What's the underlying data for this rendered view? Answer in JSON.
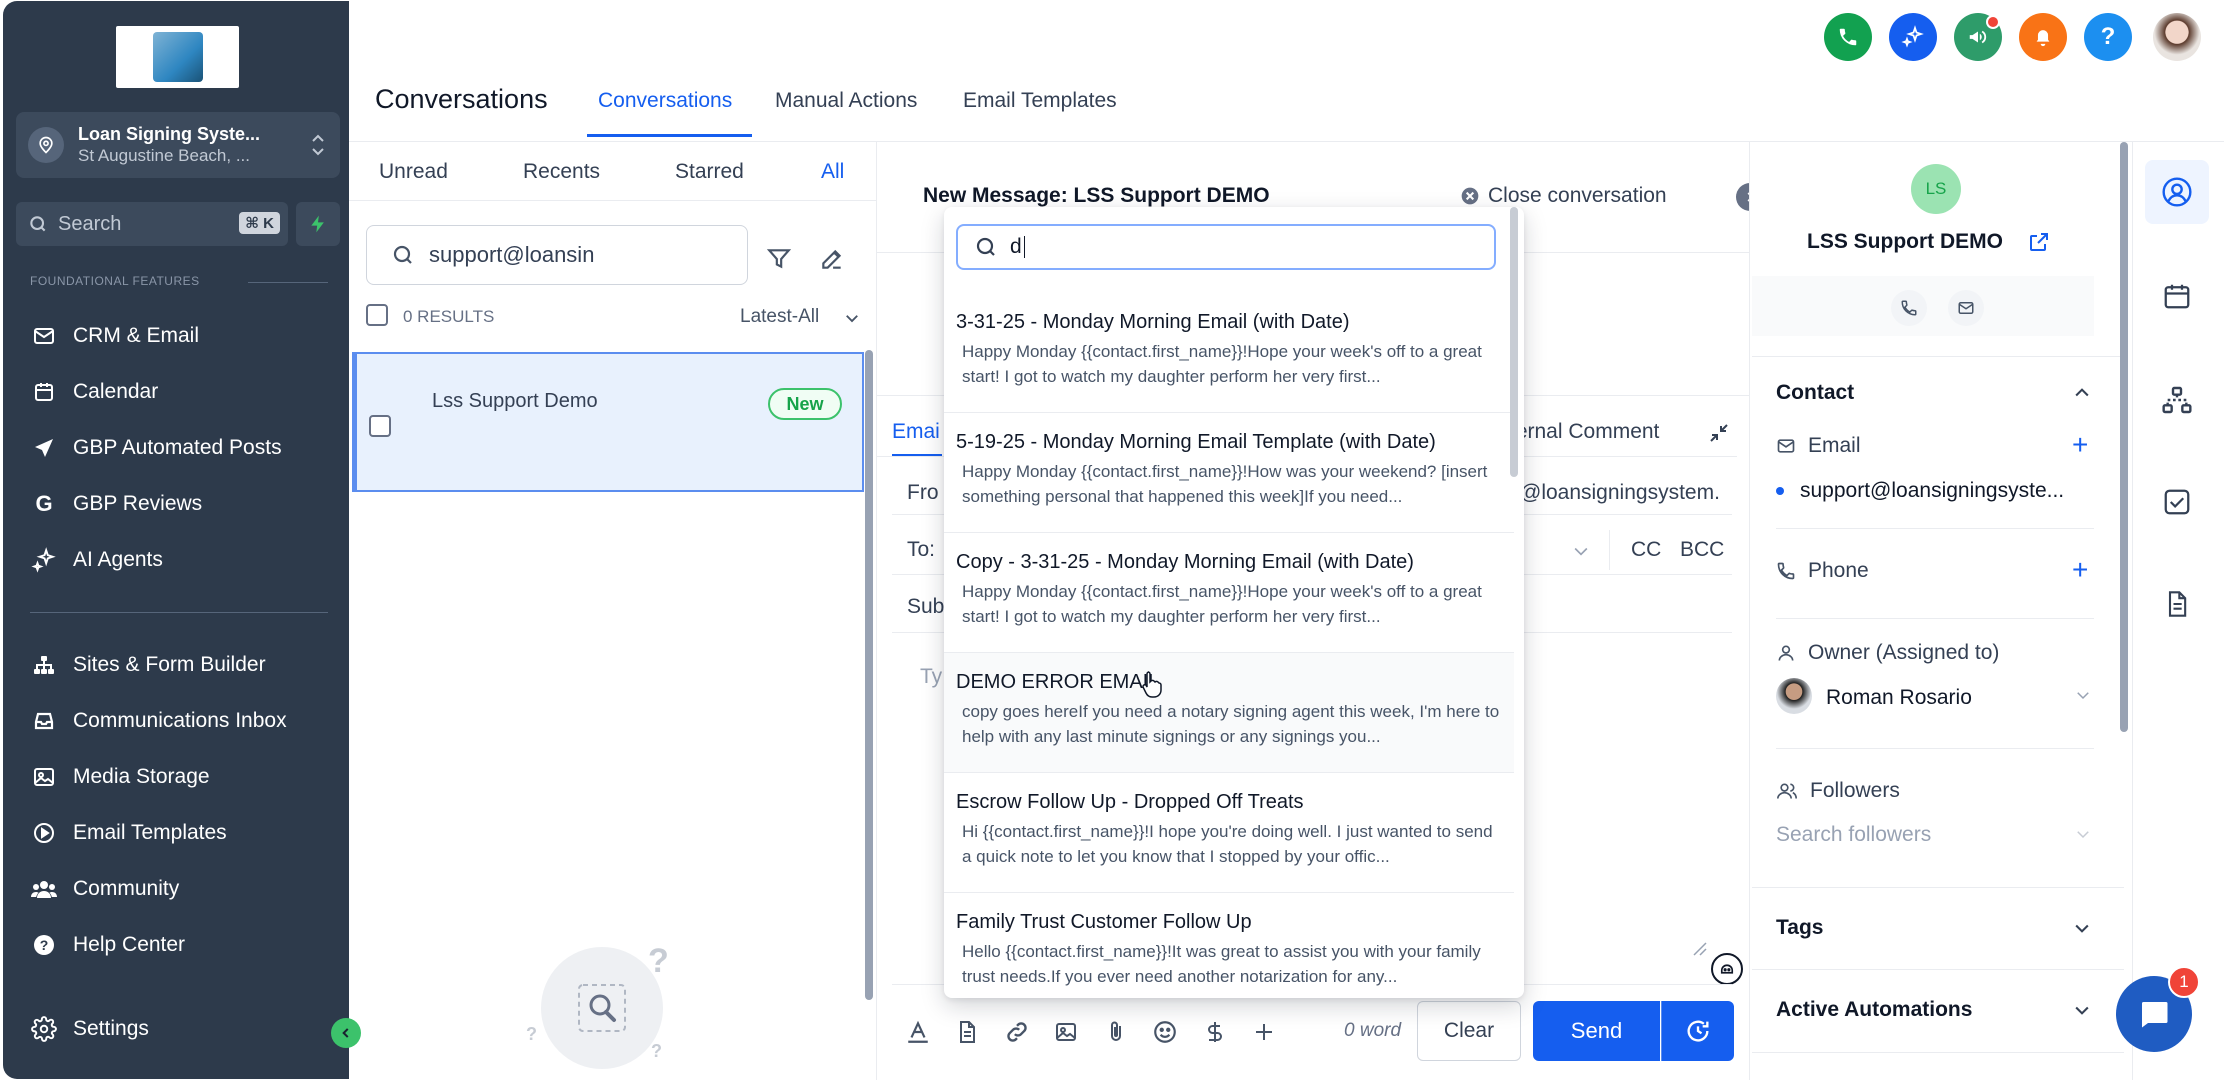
{
  "sidebar": {
    "location_name": "Loan Signing Syste...",
    "location_sub": "St Augustine Beach, ...",
    "search_placeholder": "Search",
    "search_shortcut": "⌘ K",
    "section_label": "FOUNDATIONAL FEATURES",
    "items_group1": [
      {
        "label": "CRM & Email",
        "icon": "mail-icon"
      },
      {
        "label": "Calendar",
        "icon": "calendar-icon"
      },
      {
        "label": "GBP Automated Posts",
        "icon": "send-arrow-icon"
      },
      {
        "label": "GBP Reviews",
        "icon": "google-g-icon"
      },
      {
        "label": "AI Agents",
        "icon": "sparkles-icon"
      }
    ],
    "items_group2": [
      {
        "label": "Sites & Form Builder",
        "icon": "sitemap-icon"
      },
      {
        "label": "Communications Inbox",
        "icon": "inbox-icon"
      },
      {
        "label": "Media Storage",
        "icon": "image-icon"
      },
      {
        "label": "Email Templates",
        "icon": "play-circle-icon"
      },
      {
        "label": "Community",
        "icon": "users-icon"
      },
      {
        "label": "Help Center",
        "icon": "question-circle-icon"
      }
    ],
    "settings_label": "Settings"
  },
  "header": {
    "page_title": "Conversations",
    "tabs": [
      {
        "label": "Conversations",
        "active": true
      },
      {
        "label": "Manual Actions",
        "active": false
      },
      {
        "label": "Email Templates",
        "active": false
      }
    ],
    "top_icons": [
      {
        "name": "phone-icon",
        "color": "#12a150"
      },
      {
        "name": "ai-sparkle-icon",
        "color": "#155eef"
      },
      {
        "name": "megaphone-icon",
        "color": "#2e9c6a"
      },
      {
        "name": "bell-icon",
        "color": "#f97316"
      },
      {
        "name": "help-icon",
        "color": "#1c8ff0"
      }
    ]
  },
  "list": {
    "filter_tabs": [
      {
        "label": "Unread",
        "active": false
      },
      {
        "label": "Recents",
        "active": false
      },
      {
        "label": "Starred",
        "active": false
      },
      {
        "label": "All",
        "active": true
      }
    ],
    "search_value": "support@loansin",
    "results_count": "0 RESULTS",
    "sort_label": "Latest-All",
    "conversation": {
      "name": "Lss Support Demo",
      "badge": "New"
    }
  },
  "compose": {
    "title": "New Message: LSS Support DEMO",
    "close_label": "Close conversation",
    "tab_email": "Emai",
    "tab_internal": "ternal Comment",
    "from_label": "Fro",
    "from_value": "@loansigningsystem.",
    "to_label": "To:",
    "cc_label": "CC",
    "bcc_label": "BCC",
    "subject_label": "Sub",
    "body_placeholder": "Ty",
    "word_count": "0 word",
    "clear_label": "Clear",
    "send_label": "Send"
  },
  "templates": {
    "search_value": "d",
    "items": [
      {
        "title": "3-31-25 - Monday Morning Email (with Date)",
        "desc": "Happy Monday {{contact.first_name}}!Hope your week's off to a great start! I got to watch my daughter perform her very first..."
      },
      {
        "title": "5-19-25 - Monday Morning Email Template (with Date)",
        "desc": "Happy Monday {{contact.first_name}}!How was your weekend? [insert something personal that happened this week]If you need..."
      },
      {
        "title": "Copy - 3-31-25 - Monday Morning Email (with Date)",
        "desc": "Happy Monday {{contact.first_name}}!Hope your week's off to a great start! I got to watch my daughter perform her very first..."
      },
      {
        "title": "DEMO ERROR EMAIL",
        "desc": "copy goes hereIf you need a notary signing agent this week, I'm here to help with any last minute signings or any signings you..."
      },
      {
        "title": "Escrow Follow Up - Dropped Off Treats",
        "desc": "Hi {{contact.first_name}}!I hope you're doing well. I just wanted to send a quick note to let you know that I stopped by your offic..."
      },
      {
        "title": "Family Trust Customer Follow Up",
        "desc": "Hello {{contact.first_name}}!It was great to assist you with your family trust needs.If you ever need another notarization for any..."
      }
    ]
  },
  "contact": {
    "initials": "LS",
    "name": "LSS Support DEMO",
    "section_contact": "Contact",
    "email_label": "Email",
    "email_value": "support@loansigningsyste...",
    "phone_label": "Phone",
    "owner_label": "Owner (Assigned to)",
    "owner_name": "Roman Rosario",
    "followers_label": "Followers",
    "followers_placeholder": "Search followers",
    "section_tags": "Tags",
    "section_automations": "Active Automations"
  },
  "chat_badge": "1",
  "colors": {
    "sidebar_bg": "#2d3a4b",
    "accent": "#155eef",
    "success": "#16a34a"
  }
}
